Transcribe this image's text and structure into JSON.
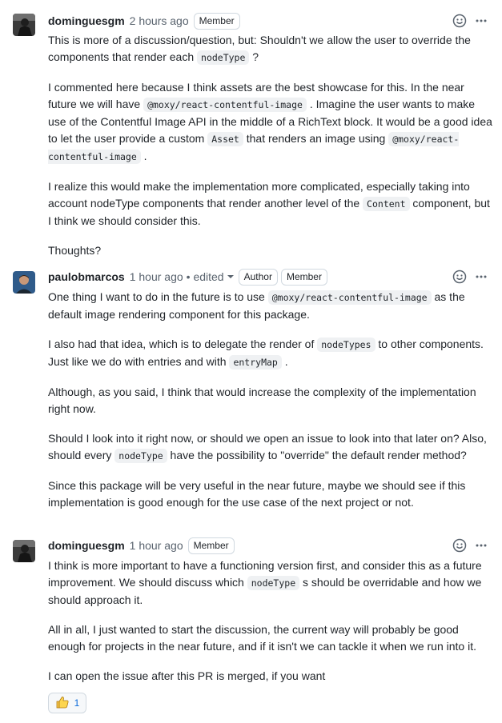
{
  "comments": [
    {
      "author": "dominguesgm",
      "time": "2 hours ago",
      "edited": "",
      "badges": [
        "Member"
      ],
      "paragraphs": [
        [
          "This is more of a discussion/question, but: Shouldn't we allow the user to override the components that render each ",
          {
            "code": "nodeType"
          },
          " ?"
        ],
        [
          "I commented here because I think assets are the best showcase for this. In the near future we will have ",
          {
            "code": "@moxy/react-contentful-image"
          },
          " . Imagine the user wants to make use of the Contentful Image API in the middle of a RichText block. It would be a good idea to let the user provide a custom ",
          {
            "code": "Asset"
          },
          " that renders an image using ",
          {
            "code": "@moxy/react-contentful-image"
          },
          " ."
        ],
        [
          "I realize this would make the implementation more complicated, especially taking into account nodeType components that render another level of the ",
          {
            "code": "Content"
          },
          " component, but I think we should consider this."
        ],
        [
          "Thoughts?"
        ]
      ]
    },
    {
      "author": "paulobmarcos",
      "time": "1 hour ago",
      "edited": "• edited",
      "badges": [
        "Author",
        "Member"
      ],
      "paragraphs": [
        [
          "One thing I want to do in the future is to use ",
          {
            "code": "@moxy/react-contentful-image"
          },
          " as the default image rendering component for this package."
        ],
        [
          "I also had that idea, which is to delegate the render of ",
          {
            "code": "nodeTypes"
          },
          " to other components. Just like we do with entries and with ",
          {
            "code": "entryMap"
          },
          " ."
        ],
        [
          "Although, as you said, I think that would increase the complexity of the implementation right now."
        ],
        [
          "Should I look into it right now, or should we open an issue to look into that later on? Also, should every ",
          {
            "code": "nodeType"
          },
          " have the possibility to \"override\" the default render method?"
        ],
        [
          "Since this package will be very useful in the near future, maybe we should see if this implementation is good enough for the use case of the next project or not."
        ]
      ]
    },
    {
      "author": "dominguesgm",
      "time": "1 hour ago",
      "edited": "",
      "badges": [
        "Member"
      ],
      "paragraphs": [
        [
          "I think is more important to have a functioning version first, and consider this as a future improvement. We should discuss which ",
          {
            "code": "nodeType"
          },
          " s should be overridable and how we should approach it."
        ],
        [
          "All in all, I just wanted to start the discussion, the current way will probably be good enough for projects in the near future, and if it isn't we can tackle it when we run into it."
        ],
        [
          "I can open the issue after this PR is merged, if you want"
        ]
      ],
      "reaction": {
        "icon": "thumbs-up-icon",
        "count": "1"
      }
    }
  ],
  "colors": {
    "link": "#0969da",
    "muted": "#59636e",
    "border": "#d1d9e0",
    "code_bg": "#eff1f3"
  }
}
